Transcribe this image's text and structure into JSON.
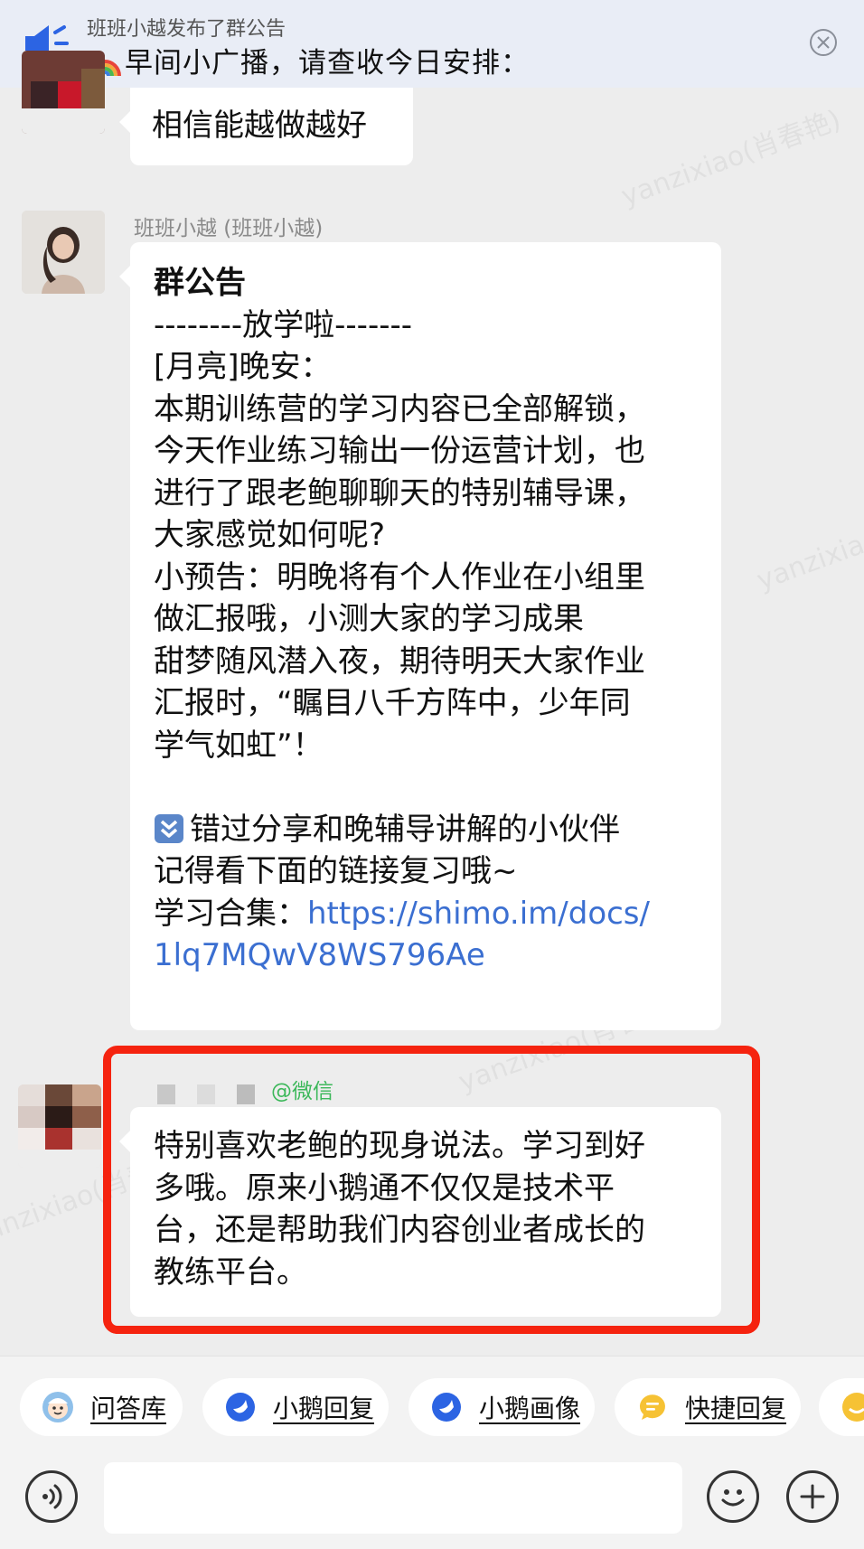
{
  "notice": {
    "publisher": "班班小越发布了群公告",
    "text": "早间小广播，请查收今日安排："
  },
  "messages": {
    "first": {
      "text": "相信能越做越好"
    },
    "announcement": {
      "sender": "班班小越 (班班小越)",
      "title": "群公告",
      "lines": [
        "--------放学啦-------",
        "[月亮]晚安：",
        "本期训练营的学习内容已全部解锁，",
        "今天作业练习输出一份运营计划，也",
        "进行了跟老鲍聊聊天的特别辅导课，",
        "大家感觉如何呢?",
        "小预告：明晚将有个人作业在小组里",
        "做汇报哦，小测大家的学习成果",
        "甜梦随风潜入夜，期待明天大家作业",
        "汇报时，“瞩目八千方阵中，少年同",
        "学气如虹”！"
      ],
      "review_lines": [
        "错过分享和晚辅导讲解的小伙伴",
        "记得看下面的链接复习哦~"
      ],
      "collection_label": "学习合集：",
      "link_part1": "https://shimo.im/docs/",
      "link_part2": "1lq7MQwV8WS796Ae"
    },
    "wechat_user": {
      "source_tag": "@微信",
      "lines": [
        "特别喜欢老鲍的现身说法。学习到好",
        "多哦。原来小鹅通不仅仅是技术平",
        "台，还是帮助我们内容创业者成长的",
        "教练平台。"
      ]
    }
  },
  "watermark": "yanzixiao(肖春艳)",
  "quick_replies": [
    "问答库",
    "小鹅回复",
    "小鹅画像",
    "快捷回复"
  ],
  "colors": {
    "highlight_border": "#f5230f",
    "link": "#3b6fd1",
    "source_tag": "#3cb85a",
    "chip_icon_blue": "#2c64e3",
    "chip_icon_yellow": "#f6c234"
  }
}
